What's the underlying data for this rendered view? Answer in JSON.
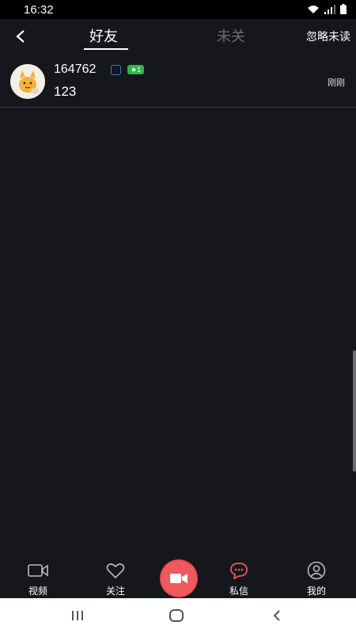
{
  "status_bar": {
    "time": "16:32"
  },
  "header": {
    "tabs": [
      {
        "label": "好友",
        "active": true
      },
      {
        "label": "未关",
        "active": false
      }
    ],
    "ignore_unread_label": "忽略未读"
  },
  "conversations": [
    {
      "name": "164762",
      "message": "123",
      "time": "刚刚",
      "level_badge": "★1"
    }
  ],
  "bottom_nav": {
    "items": [
      {
        "label": "视频",
        "icon": "video-camera-icon"
      },
      {
        "label": "关注",
        "icon": "heart-icon"
      },
      {
        "label": "",
        "icon": "record-camera-icon"
      },
      {
        "label": "私信",
        "icon": "chat-bubble-icon"
      },
      {
        "label": "我的",
        "icon": "user-profile-icon"
      }
    ]
  },
  "colors": {
    "background": "#16171c",
    "accent_red": "#f0595e",
    "level_green": "#2fb44a",
    "inactive_tab": "#6b6b70"
  }
}
